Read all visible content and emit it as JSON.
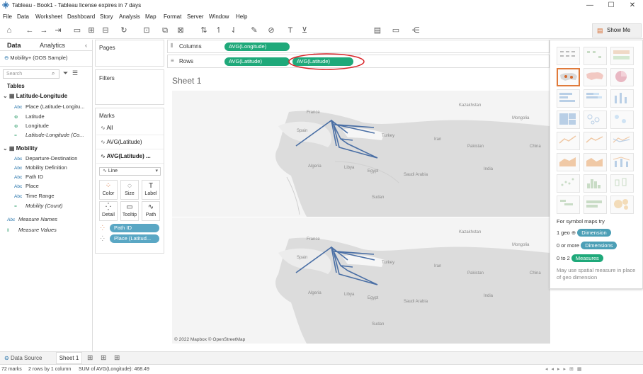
{
  "window": {
    "title": "Tableau - Book1 - Tableau license expires in 7 days",
    "minimize": "—",
    "maximize": "☐",
    "close": "✕"
  },
  "menu": [
    "File",
    "Data",
    "Worksheet",
    "Dashboard",
    "Story",
    "Analysis",
    "Map",
    "Format",
    "Server",
    "Window",
    "Help"
  ],
  "left_pane": {
    "tab_data": "Data",
    "tab_analytics": "Analytics",
    "datasource": "Mobility+ (OOS Sample)",
    "search_placeholder": "Search",
    "tables_label": "Tables",
    "groups": [
      {
        "name": "Latitude-Longitude",
        "fields": [
          {
            "icon": "Abc",
            "name": "Place (Latitude-Longitu...",
            "kind": "dim"
          },
          {
            "icon": "⊕",
            "name": "Latitude",
            "kind": "geo"
          },
          {
            "icon": "⊕",
            "name": "Longitude",
            "kind": "geo"
          },
          {
            "icon": "=",
            "name": "Latitude-Longitude (Co...",
            "kind": "measure"
          }
        ]
      },
      {
        "name": "Mobility",
        "fields": [
          {
            "icon": "Abc",
            "name": "Departure-Destination",
            "kind": "dim"
          },
          {
            "icon": "Abc",
            "name": "Mobility Definition",
            "kind": "dim"
          },
          {
            "icon": "Abc",
            "name": "Path ID",
            "kind": "dim"
          },
          {
            "icon": "Abc",
            "name": "Place",
            "kind": "dim"
          },
          {
            "icon": "Abc",
            "name": "Time Range",
            "kind": "dim"
          },
          {
            "icon": "=",
            "name": "Mobility (Count)",
            "kind": "measure"
          }
        ]
      }
    ],
    "extra": [
      {
        "icon": "Abc",
        "name": "Measure Names"
      },
      {
        "icon": "‖",
        "name": "Measure Values"
      }
    ]
  },
  "cards": {
    "pages": "Pages",
    "filters": "Filters",
    "marks": "Marks",
    "mark_rows": [
      "All",
      "AVG(Latitude)",
      "AVG(Latitude) ..."
    ],
    "mark_type": "Line",
    "buttons": [
      {
        "label": "Color",
        "icon": "⁘"
      },
      {
        "label": "Size",
        "icon": "◌"
      },
      {
        "label": "Label",
        "icon": "T"
      },
      {
        "label": "Detail",
        "icon": "⁛"
      },
      {
        "label": "Tooltip",
        "icon": "▭"
      },
      {
        "label": "Path",
        "icon": "∿"
      }
    ],
    "pills": [
      "Path ID",
      "Place (Latitud..."
    ]
  },
  "shelves": {
    "columns_label": "Columns",
    "rows_label": "Rows",
    "columns_pills": [
      "AVG(Longitude)"
    ],
    "rows_pills": [
      "AVG(Latitude)",
      "AVG(Latitude)"
    ]
  },
  "sheet": {
    "title": "Sheet 1",
    "attribution": "© 2022 Mapbox © OpenStreetMap",
    "map_labels": [
      "France",
      "Spain",
      "Turkey",
      "Algeria",
      "Libya",
      "Egypt",
      "Saudi Arabia",
      "Sudan",
      "Kazakhstan",
      "Iran",
      "Pakistan",
      "India",
      "Mongolia",
      "China"
    ]
  },
  "show_me": {
    "button": "Show Me",
    "hint_title": "For symbol maps try",
    "hint_bold": "symbol maps",
    "req1": "1 geo",
    "req1_pill": "Dimension",
    "req2": "0 or more",
    "req2_pill": "Dimensions",
    "req3": "0 to 2",
    "req3_pill": "Measures",
    "note": "May use spatial measure in place of geo dimension"
  },
  "bottom": {
    "data_source": "Data Source",
    "sheet_tab": "Sheet 1"
  },
  "status": {
    "marks": "72 marks",
    "grid": "2 rows by 1 column",
    "sum": "SUM of AVG(Longitude): 468.49"
  },
  "colors": {
    "accent": "#1fa97a",
    "pill_blue": "#5aa7c4",
    "path_line": "#4a6fa5",
    "highlight": "#d9252a"
  }
}
